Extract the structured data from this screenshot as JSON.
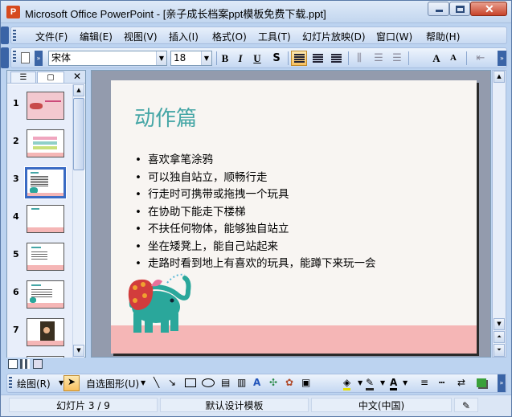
{
  "window": {
    "app_icon_label": "P",
    "title": "Microsoft Office PowerPoint - [亲子成长档案ppt模板免费下载.ppt]"
  },
  "menu": {
    "items": [
      "文件(F)",
      "编辑(E)",
      "视图(V)",
      "插入(I)",
      "格式(O)",
      "工具(T)",
      "幻灯片放映(D)",
      "窗口(W)",
      "帮助(H)"
    ]
  },
  "format_toolbar": {
    "font_name": "宋体",
    "font_size": "18",
    "bold_label": "B",
    "italic_label": "I",
    "underline_label": "U",
    "shadow_label": "S",
    "grow_font_label": "A",
    "shrink_font_label": "A"
  },
  "slides_panel": {
    "close_label": "✕",
    "thumbnails": [
      {
        "number": "1"
      },
      {
        "number": "2"
      },
      {
        "number": "3"
      },
      {
        "number": "4"
      },
      {
        "number": "5"
      },
      {
        "number": "6"
      },
      {
        "number": "7"
      }
    ],
    "selected": "3"
  },
  "slide": {
    "title": "动作篇",
    "bullets": [
      "喜欢拿笔涂鸦",
      "可以独自站立，顺畅行走",
      "行走时可携带或拖拽一个玩具",
      "在协助下能走下楼梯",
      "不扶任何物体，能够独自站立",
      "坐在矮凳上，能自己站起来",
      "走路时看到地上有喜欢的玩具，能蹲下来玩一会"
    ]
  },
  "drawing_toolbar": {
    "draw_label": "绘图(R)",
    "autoshapes_label": "自选图形(U)"
  },
  "status": {
    "slide_indicator": "幻灯片 3 / 9",
    "design": "默认设计模板",
    "language": "中文(中国)"
  },
  "colors": {
    "title_teal": "#45a6a6",
    "band_pink": "#f5b6b6",
    "elephant_teal": "#2aa79b",
    "selection_blue": "#3a6bc4"
  }
}
